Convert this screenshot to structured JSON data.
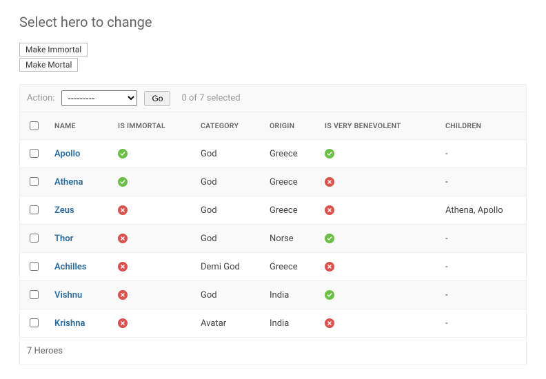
{
  "page_title": "Select hero to change",
  "buttons": {
    "make_immortal": "Make Immortal",
    "make_mortal": "Make Mortal"
  },
  "action_bar": {
    "label": "Action:",
    "placeholder_option": "---------",
    "go_label": "Go",
    "selection_text": "0 of 7 selected"
  },
  "columns": {
    "name": "NAME",
    "is_immortal": "IS IMMORTAL",
    "category": "CATEGORY",
    "origin": "ORIGIN",
    "is_very_benevolent": "IS VERY BENEVOLENT",
    "children": "CHILDREN"
  },
  "rows": [
    {
      "name": "Apollo",
      "is_immortal": true,
      "category": "God",
      "origin": "Greece",
      "is_very_benevolent": true,
      "children": "-"
    },
    {
      "name": "Athena",
      "is_immortal": true,
      "category": "God",
      "origin": "Greece",
      "is_very_benevolent": false,
      "children": "-"
    },
    {
      "name": "Zeus",
      "is_immortal": false,
      "category": "God",
      "origin": "Greece",
      "is_very_benevolent": false,
      "children": "Athena, Apollo"
    },
    {
      "name": "Thor",
      "is_immortal": false,
      "category": "God",
      "origin": "Norse",
      "is_very_benevolent": true,
      "children": "-"
    },
    {
      "name": "Achilles",
      "is_immortal": false,
      "category": "Demi God",
      "origin": "Greece",
      "is_very_benevolent": false,
      "children": "-"
    },
    {
      "name": "Vishnu",
      "is_immortal": false,
      "category": "God",
      "origin": "India",
      "is_very_benevolent": true,
      "children": "-"
    },
    {
      "name": "Krishna",
      "is_immortal": false,
      "category": "Avatar",
      "origin": "India",
      "is_very_benevolent": false,
      "children": "-"
    }
  ],
  "footer_text": "7 Heroes"
}
